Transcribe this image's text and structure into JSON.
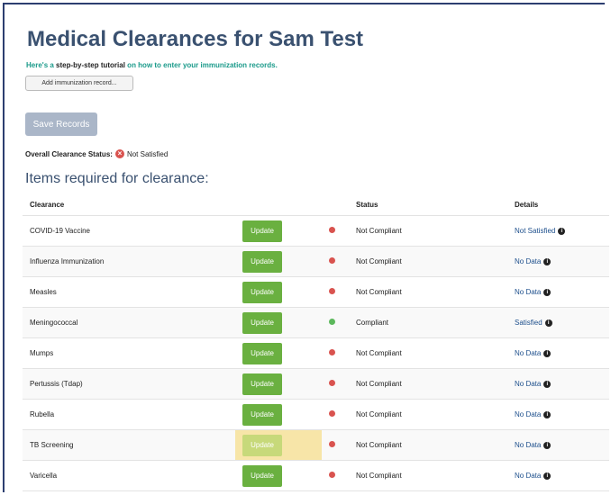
{
  "page": {
    "title": "Medical Clearances for Sam Test",
    "tutorial_pre": "Here's a ",
    "tutorial_bold": "step-by-step tutorial",
    "tutorial_post": " on how to enter your immunization records.",
    "add_button": "Add immunization record...",
    "save_button": "Save Records",
    "overall_label": "Overall Clearance Status:",
    "overall_value": "Not Satisfied",
    "items_heading": "Items required for clearance:"
  },
  "table": {
    "headers": {
      "clearance": "Clearance",
      "status": "Status",
      "details": "Details"
    },
    "rows": [
      {
        "clearance": "COVID-19 Vaccine",
        "button": "Update",
        "status": "Not Compliant",
        "compliant": false,
        "details": "Not Satisfied"
      },
      {
        "clearance": "Influenza Immunization",
        "button": "Update",
        "status": "Not Compliant",
        "compliant": false,
        "details": "No Data"
      },
      {
        "clearance": "Measles",
        "button": "Update",
        "status": "Not Compliant",
        "compliant": false,
        "details": "No Data"
      },
      {
        "clearance": "Meningococcal",
        "button": "Update",
        "status": "Compliant",
        "compliant": true,
        "details": "Satisfied"
      },
      {
        "clearance": "Mumps",
        "button": "Update",
        "status": "Not Compliant",
        "compliant": false,
        "details": "No Data"
      },
      {
        "clearance": "Pertussis (Tdap)",
        "button": "Update",
        "status": "Not Compliant",
        "compliant": false,
        "details": "No Data"
      },
      {
        "clearance": "Rubella",
        "button": "Update",
        "status": "Not Compliant",
        "compliant": false,
        "details": "No Data"
      },
      {
        "clearance": "TB Screening",
        "button": "Update",
        "status": "Not Compliant",
        "compliant": false,
        "details": "No Data",
        "highlighted": true
      },
      {
        "clearance": "Varicella",
        "button": "Update",
        "status": "Not Compliant",
        "compliant": false,
        "details": "No Data"
      }
    ]
  },
  "colors": {
    "title": "#3a5170",
    "tutorial": "#1a9a8a",
    "update_button": "#6ab040",
    "not_compliant": "#d9534f",
    "compliant": "#5cb85c",
    "highlight": "#f7e5a8"
  }
}
